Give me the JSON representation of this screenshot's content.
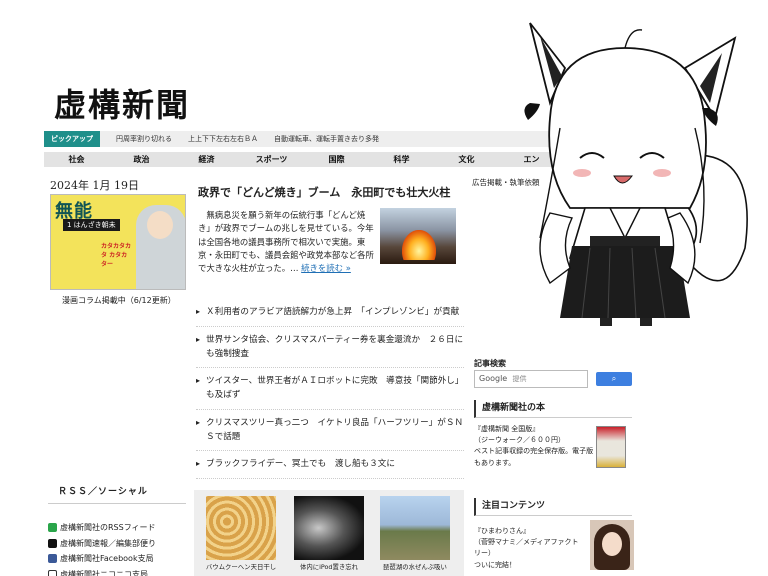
{
  "site": {
    "logo": "虚構新聞"
  },
  "pickup": {
    "label": "ピックアップ",
    "items": [
      "円周率割り切れる",
      "上上下下左右左右ＢＡ",
      "自動運転車、運転手置き去り多発"
    ]
  },
  "nav": [
    "社会",
    "政治",
    "経済",
    "スポーツ",
    "国際",
    "科学",
    "文化",
    "エン"
  ],
  "date": "2024年 1月 19日",
  "manga": {
    "cover_title": "無能",
    "cover_tag": "1 はんざき朝未",
    "cover_side": "カタカタカタ カタカター",
    "caption": "漫画コラム掲載中（6/12更新）"
  },
  "lead": {
    "headline": "政界で「どんど焼き」ブーム　永田町でも壮大火柱",
    "body": "無病息災を願う新年の伝統行事「どんど焼き」が政界でブームの兆しを見せている。今年は全国各地の議員事務所で相次いで実施。東京・永田町でも、議員会館や政党本部など各所で大きな火柱が立った。…",
    "more": "続きを読む »"
  },
  "news": [
    "Ｘ利用者のアラビア語読解力が急上昇　「インプレゾンビ」が貢献",
    "世界サンタ協会、クリスマスパーティー券を裏金還流か　２６日にも強制捜査",
    "ツイスター、世界王者がＡＩロボットに完敗　導意技「関節外し」も及ばず",
    "クリスマスツリー真っ二つ　イケトリ良品「ハーフツリー」がＳＮＳで話題",
    "ブラックフライデー、冥土でも　渡し船も３文に"
  ],
  "rss": {
    "title": "ＲＳＳ／ソーシャル",
    "items": [
      {
        "label": "虚構新聞社のRSSフィード",
        "icon": "rss-icon",
        "color": "#2aa54a"
      },
      {
        "label": "虚構新聞速報／編集部便り",
        "icon": "x-twitter-icon",
        "color": "#111111"
      },
      {
        "label": "虚構新聞社Facebook支局",
        "icon": "facebook-icon",
        "color": "#3b5998"
      },
      {
        "label": "虚構新聞社ニコニコ支局",
        "icon": "niconico-icon",
        "color": "#333333"
      }
    ]
  },
  "thumbs": [
    {
      "caption": "バウムクーヘン天日干し"
    },
    {
      "caption": "体内にiPod置き忘れ"
    },
    {
      "caption": "琵琶湖の水ぜんぶ吸い"
    }
  ],
  "sidebar": {
    "ad_text": "広告掲載・執筆依頼",
    "search_title": "記事検索",
    "search_google": "Google",
    "search_placeholder": "提供",
    "search_button": "検索",
    "book_section_title": "虚構新聞社の本",
    "book_text": "『虚構新聞 全国版』\n（ジーウォーク／６００円）\nベスト記事収録の完全保存版。電子版もあります。",
    "featured_title": "注目コンテンツ",
    "featured_text": "『ひまわりさん』\n（菅野マナミ／メディアファクトリー）\nついに完結！"
  },
  "colors": {
    "pickup_accent": "#1f8f8a",
    "search_button": "#3d7fe0",
    "link": "#1f6fb5"
  }
}
